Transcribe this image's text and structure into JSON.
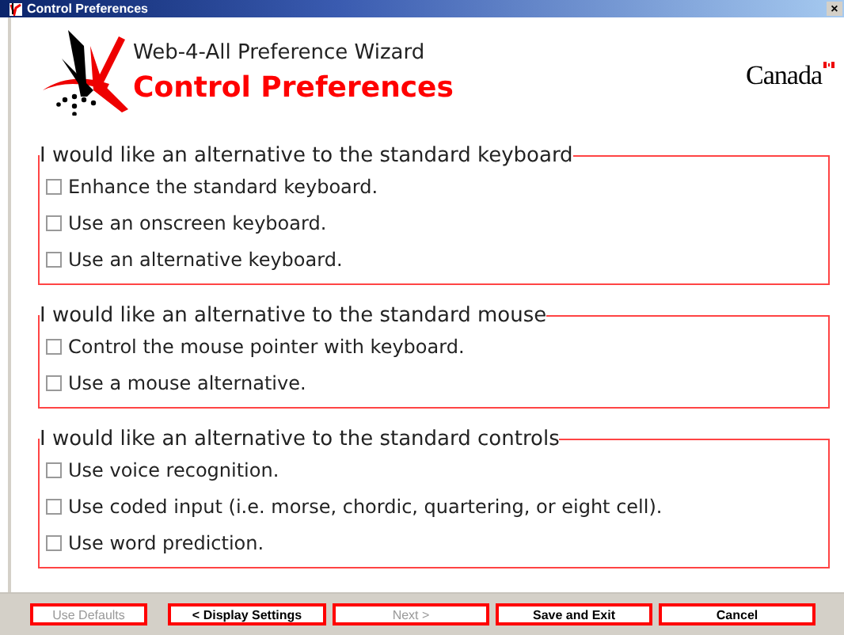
{
  "window": {
    "title": "Control Preferences",
    "close": "×"
  },
  "header": {
    "subtitle": "Web-4-All Preference Wizard",
    "title": "Control Preferences",
    "wordmark": "Canada"
  },
  "groups": [
    {
      "legend": "I would like an alternative to the standard keyboard",
      "options": [
        {
          "label": "Enhance the standard keyboard.",
          "checked": false
        },
        {
          "label": "Use an onscreen keyboard.",
          "checked": false
        },
        {
          "label": "Use an alternative keyboard.",
          "checked": false
        }
      ]
    },
    {
      "legend": "I would like an alternative to the standard mouse",
      "options": [
        {
          "label": "Control the mouse pointer with keyboard.",
          "checked": false
        },
        {
          "label": "Use a mouse alternative.",
          "checked": false
        }
      ]
    },
    {
      "legend": "I would like an alternative to the standard controls",
      "options": [
        {
          "label": "Use voice recognition.",
          "checked": false
        },
        {
          "label": "Use coded input (i.e. morse, chordic, quartering, or eight cell).",
          "checked": false
        },
        {
          "label": "Use word prediction.",
          "checked": false
        }
      ]
    }
  ],
  "buttons": [
    {
      "label": "Use Defaults",
      "disabled": true
    },
    {
      "label": "< Display Settings",
      "disabled": false
    },
    {
      "label": "Next >",
      "disabled": true
    },
    {
      "label": "Save and Exit",
      "disabled": false
    },
    {
      "label": "Cancel",
      "disabled": false
    }
  ]
}
